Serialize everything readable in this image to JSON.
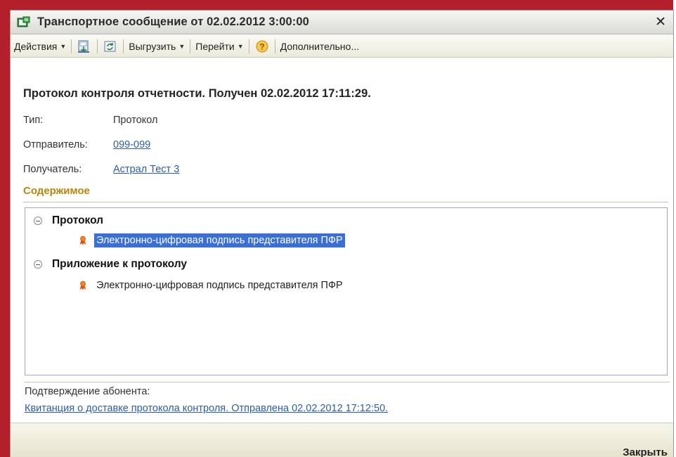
{
  "window": {
    "title": "Транспортное сообщение от 02.02.2012 3:00:00",
    "close_glyph": "✕"
  },
  "toolbar": {
    "actions_label": "Действия",
    "export_label": "Выгрузить",
    "goto_label": "Перейти",
    "more_label": "Дополнительно...",
    "help_glyph": "?"
  },
  "content": {
    "heading": "Протокол контроля отчетности. Получен 02.02.2012 17:11:29.",
    "fields": [
      {
        "label": "Тип:",
        "value": "Протокол"
      },
      {
        "label": "Отправитель:",
        "value": "099-099"
      },
      {
        "label": "Получатель:",
        "value": "Астрал Тест 3"
      }
    ],
    "section_title": "Содержимое",
    "tree": [
      {
        "label": "Протокол",
        "child": "Электронно-цифровая подпись представителя ПФР"
      },
      {
        "label": "Приложение к протоколу",
        "child": "Электронно-цифровая подпись представителя ПФР"
      }
    ],
    "confirm_label": "Подтверждение абонента:",
    "confirm_link": "Квитанция о доставке протокола контроля. Отправлена 02.02.2012 17:12:50."
  },
  "footer": {
    "close_label": "Закрыть"
  },
  "colors": {
    "frame": "#b3202a",
    "link": "#2a5db0",
    "section_title": "#b8860b",
    "selection": "#3a6fd8"
  }
}
